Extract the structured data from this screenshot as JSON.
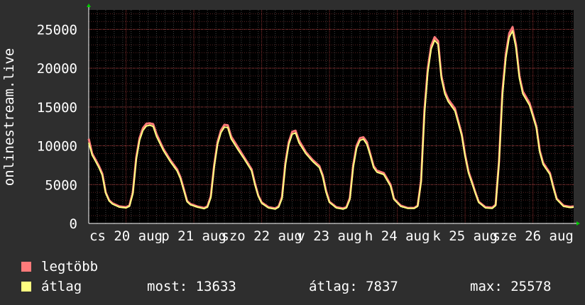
{
  "chart_data": {
    "type": "line",
    "ylabel": "onlinestream.live",
    "ylim": [
      0,
      27500
    ],
    "yticks": [
      0,
      5000,
      10000,
      15000,
      20000,
      25000
    ],
    "xlim": [
      0,
      7.15
    ],
    "xticks": [
      {
        "pos": 0.55,
        "label": "cs 20 aug"
      },
      {
        "pos": 1.55,
        "label": "p 21 aug"
      },
      {
        "pos": 2.55,
        "label": "szo 22 aug"
      },
      {
        "pos": 3.55,
        "label": "v 23 aug"
      },
      {
        "pos": 4.55,
        "label": "h 24 aug"
      },
      {
        "pos": 5.55,
        "label": "k 25 aug"
      },
      {
        "pos": 6.55,
        "label": "sze 26 aug"
      }
    ],
    "grid": true,
    "series": [
      {
        "name": "legtöbb",
        "color": "#ff7a7a",
        "points": [
          [
            0,
            10900
          ],
          [
            0.05,
            9000
          ],
          [
            0.1,
            8200
          ],
          [
            0.15,
            7400
          ],
          [
            0.2,
            6400
          ],
          [
            0.25,
            4000
          ],
          [
            0.3,
            3000
          ],
          [
            0.35,
            2600
          ],
          [
            0.45,
            2200
          ],
          [
            0.55,
            2100
          ],
          [
            0.6,
            2300
          ],
          [
            0.65,
            4000
          ],
          [
            0.7,
            8500
          ],
          [
            0.75,
            11000
          ],
          [
            0.8,
            12300
          ],
          [
            0.85,
            12850
          ],
          [
            0.9,
            12900
          ],
          [
            0.95,
            12800
          ],
          [
            1.0,
            11500
          ],
          [
            1.1,
            9600
          ],
          [
            1.2,
            8200
          ],
          [
            1.3,
            7000
          ],
          [
            1.35,
            6000
          ],
          [
            1.4,
            4500
          ],
          [
            1.45,
            2900
          ],
          [
            1.5,
            2500
          ],
          [
            1.6,
            2200
          ],
          [
            1.7,
            2000
          ],
          [
            1.75,
            2200
          ],
          [
            1.8,
            3500
          ],
          [
            1.85,
            7500
          ],
          [
            1.9,
            10500
          ],
          [
            1.95,
            12000
          ],
          [
            2.0,
            12700
          ],
          [
            2.05,
            12650
          ],
          [
            2.1,
            11200
          ],
          [
            2.2,
            9800
          ],
          [
            2.3,
            8400
          ],
          [
            2.4,
            7000
          ],
          [
            2.45,
            5200
          ],
          [
            2.5,
            3600
          ],
          [
            2.55,
            2700
          ],
          [
            2.65,
            2100
          ],
          [
            2.75,
            1950
          ],
          [
            2.8,
            2200
          ],
          [
            2.85,
            3400
          ],
          [
            2.9,
            7800
          ],
          [
            2.95,
            10500
          ],
          [
            3.0,
            11800
          ],
          [
            3.05,
            11950
          ],
          [
            3.1,
            10700
          ],
          [
            3.2,
            9200
          ],
          [
            3.3,
            8200
          ],
          [
            3.4,
            7400
          ],
          [
            3.45,
            6200
          ],
          [
            3.5,
            4200
          ],
          [
            3.55,
            2800
          ],
          [
            3.65,
            2100
          ],
          [
            3.75,
            1950
          ],
          [
            3.8,
            2100
          ],
          [
            3.85,
            3300
          ],
          [
            3.9,
            7500
          ],
          [
            3.95,
            10000
          ],
          [
            4.0,
            11000
          ],
          [
            4.05,
            11100
          ],
          [
            4.1,
            10500
          ],
          [
            4.15,
            9000
          ],
          [
            4.2,
            7400
          ],
          [
            4.25,
            6800
          ],
          [
            4.35,
            6500
          ],
          [
            4.45,
            5000
          ],
          [
            4.5,
            3200
          ],
          [
            4.6,
            2300
          ],
          [
            4.7,
            2000
          ],
          [
            4.8,
            2000
          ],
          [
            4.85,
            2300
          ],
          [
            4.9,
            5500
          ],
          [
            4.95,
            14500
          ],
          [
            5.0,
            20000
          ],
          [
            5.05,
            22900
          ],
          [
            5.1,
            24000
          ],
          [
            5.15,
            23500
          ],
          [
            5.2,
            19000
          ],
          [
            5.25,
            17000
          ],
          [
            5.3,
            16000
          ],
          [
            5.4,
            14800
          ],
          [
            5.5,
            11500
          ],
          [
            5.55,
            8800
          ],
          [
            5.6,
            6700
          ],
          [
            5.65,
            5400
          ],
          [
            5.7,
            4000
          ],
          [
            5.75,
            2800
          ],
          [
            5.85,
            2100
          ],
          [
            5.95,
            2050
          ],
          [
            6.0,
            2400
          ],
          [
            6.05,
            8000
          ],
          [
            6.1,
            17000
          ],
          [
            6.15,
            21800
          ],
          [
            6.2,
            24500
          ],
          [
            6.25,
            25300
          ],
          [
            6.3,
            23000
          ],
          [
            6.35,
            19000
          ],
          [
            6.4,
            17000
          ],
          [
            6.5,
            15500
          ],
          [
            6.6,
            12500
          ],
          [
            6.65,
            9400
          ],
          [
            6.7,
            7800
          ],
          [
            6.8,
            6500
          ],
          [
            6.85,
            4800
          ],
          [
            6.9,
            3200
          ],
          [
            7.0,
            2300
          ],
          [
            7.1,
            2150
          ],
          [
            7.15,
            2200
          ]
        ]
      },
      {
        "name": "átlag",
        "color": "#ffff80",
        "points": [
          [
            0,
            10400
          ],
          [
            0.05,
            8800
          ],
          [
            0.1,
            8000
          ],
          [
            0.15,
            7200
          ],
          [
            0.2,
            6200
          ],
          [
            0.25,
            3900
          ],
          [
            0.3,
            2900
          ],
          [
            0.35,
            2500
          ],
          [
            0.45,
            2100
          ],
          [
            0.55,
            2000
          ],
          [
            0.6,
            2200
          ],
          [
            0.65,
            3800
          ],
          [
            0.7,
            8200
          ],
          [
            0.75,
            10700
          ],
          [
            0.8,
            12000
          ],
          [
            0.85,
            12550
          ],
          [
            0.9,
            12650
          ],
          [
            0.95,
            12500
          ],
          [
            1.0,
            11200
          ],
          [
            1.1,
            9400
          ],
          [
            1.2,
            8000
          ],
          [
            1.3,
            6800
          ],
          [
            1.35,
            5800
          ],
          [
            1.4,
            4300
          ],
          [
            1.45,
            2800
          ],
          [
            1.5,
            2400
          ],
          [
            1.6,
            2100
          ],
          [
            1.7,
            1900
          ],
          [
            1.75,
            2100
          ],
          [
            1.8,
            3300
          ],
          [
            1.85,
            7300
          ],
          [
            1.9,
            10200
          ],
          [
            1.95,
            11700
          ],
          [
            2.0,
            12400
          ],
          [
            2.05,
            12350
          ],
          [
            2.1,
            10900
          ],
          [
            2.2,
            9500
          ],
          [
            2.3,
            8200
          ],
          [
            2.4,
            6800
          ],
          [
            2.45,
            5000
          ],
          [
            2.5,
            3500
          ],
          [
            2.55,
            2600
          ],
          [
            2.65,
            2000
          ],
          [
            2.75,
            1850
          ],
          [
            2.8,
            2100
          ],
          [
            2.85,
            3200
          ],
          [
            2.9,
            7500
          ],
          [
            2.95,
            10200
          ],
          [
            3.0,
            11500
          ],
          [
            3.05,
            11650
          ],
          [
            3.1,
            10400
          ],
          [
            3.2,
            9000
          ],
          [
            3.3,
            8000
          ],
          [
            3.4,
            7200
          ],
          [
            3.45,
            6000
          ],
          [
            3.5,
            4000
          ],
          [
            3.55,
            2700
          ],
          [
            3.65,
            2000
          ],
          [
            3.75,
            1850
          ],
          [
            3.8,
            2000
          ],
          [
            3.85,
            3100
          ],
          [
            3.9,
            7200
          ],
          [
            3.95,
            9700
          ],
          [
            4.0,
            10700
          ],
          [
            4.05,
            10850
          ],
          [
            4.1,
            10200
          ],
          [
            4.15,
            8800
          ],
          [
            4.2,
            7200
          ],
          [
            4.25,
            6600
          ],
          [
            4.35,
            6300
          ],
          [
            4.45,
            4800
          ],
          [
            4.5,
            3100
          ],
          [
            4.6,
            2200
          ],
          [
            4.7,
            1950
          ],
          [
            4.8,
            1950
          ],
          [
            4.85,
            2200
          ],
          [
            4.9,
            5300
          ],
          [
            4.95,
            14000
          ],
          [
            5.0,
            19500
          ],
          [
            5.05,
            22500
          ],
          [
            5.1,
            23600
          ],
          [
            5.15,
            23100
          ],
          [
            5.2,
            18700
          ],
          [
            5.25,
            16700
          ],
          [
            5.3,
            15700
          ],
          [
            5.4,
            14500
          ],
          [
            5.5,
            11300
          ],
          [
            5.55,
            8600
          ],
          [
            5.6,
            6500
          ],
          [
            5.65,
            5200
          ],
          [
            5.7,
            3900
          ],
          [
            5.75,
            2700
          ],
          [
            5.85,
            2000
          ],
          [
            5.95,
            1950
          ],
          [
            6.0,
            2300
          ],
          [
            6.05,
            7800
          ],
          [
            6.1,
            16500
          ],
          [
            6.15,
            21300
          ],
          [
            6.2,
            24000
          ],
          [
            6.25,
            24800
          ],
          [
            6.3,
            22600
          ],
          [
            6.35,
            18700
          ],
          [
            6.4,
            16700
          ],
          [
            6.5,
            15200
          ],
          [
            6.6,
            12300
          ],
          [
            6.65,
            9200
          ],
          [
            6.7,
            7600
          ],
          [
            6.8,
            6300
          ],
          [
            6.85,
            4600
          ],
          [
            6.9,
            3100
          ],
          [
            7.0,
            2200
          ],
          [
            7.1,
            2050
          ],
          [
            7.15,
            2100
          ]
        ]
      }
    ]
  },
  "legend": {
    "items": [
      {
        "name": "legtöbb",
        "color": "#ff7a7a"
      },
      {
        "name": "átlag",
        "color": "#ffff80"
      }
    ],
    "stats": {
      "most_label": "most:",
      "most_value": "13633",
      "atlag_label": "átlag:",
      "atlag_value": "7837",
      "max_label": "max:",
      "max_value": "25578"
    }
  }
}
